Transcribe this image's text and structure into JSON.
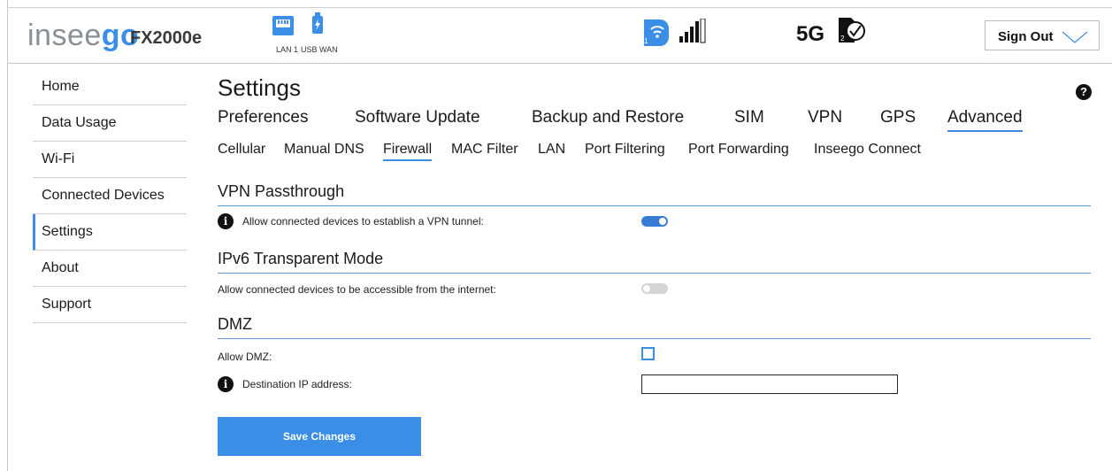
{
  "header": {
    "logo_light": "insee",
    "logo_bold": "go",
    "model": "FX2000e",
    "status": {
      "lan_label": "LAN 1",
      "usb_label": "USB WAN",
      "network": "5G",
      "sim_badge": "2",
      "wifi_badge": "1"
    },
    "signout_label": "Sign Out"
  },
  "sidebar": {
    "items": [
      {
        "label": "Home"
      },
      {
        "label": "Data Usage"
      },
      {
        "label": "Wi-Fi"
      },
      {
        "label": "Connected Devices"
      },
      {
        "label": "Settings",
        "active": true
      },
      {
        "label": "About"
      },
      {
        "label": "Support"
      }
    ]
  },
  "page": {
    "title": "Settings",
    "help_icon": "?",
    "tabs": [
      {
        "label": "Preferences"
      },
      {
        "label": "Software Update"
      },
      {
        "label": "Backup and Restore"
      },
      {
        "label": "SIM"
      },
      {
        "label": "VPN"
      },
      {
        "label": "GPS"
      },
      {
        "label": "Advanced",
        "active": true
      }
    ],
    "subtabs": [
      {
        "label": "Cellular"
      },
      {
        "label": "Manual DNS"
      },
      {
        "label": "Firewall",
        "active": true
      },
      {
        "label": "MAC Filter"
      },
      {
        "label": "LAN"
      },
      {
        "label": "Port Filtering"
      },
      {
        "label": "Port Forwarding"
      },
      {
        "label": "Inseego Connect"
      }
    ]
  },
  "firewall": {
    "vpn": {
      "heading": "VPN Passthrough",
      "label": "Allow connected devices to establish a VPN tunnel:",
      "enabled": true
    },
    "ipv6": {
      "heading": "IPv6 Transparent Mode",
      "label": "Allow connected devices to be accessible from the internet:",
      "enabled": false
    },
    "dmz": {
      "heading": "DMZ",
      "allow_label": "Allow DMZ:",
      "allow_checked": false,
      "ip_label": "Destination IP address:",
      "ip_value": ""
    },
    "save_label": "Save Changes"
  },
  "colors": {
    "accent": "#3a8ee6",
    "toggle_on": "#3a7bd5",
    "toggle_off": "#d4d4d4"
  }
}
